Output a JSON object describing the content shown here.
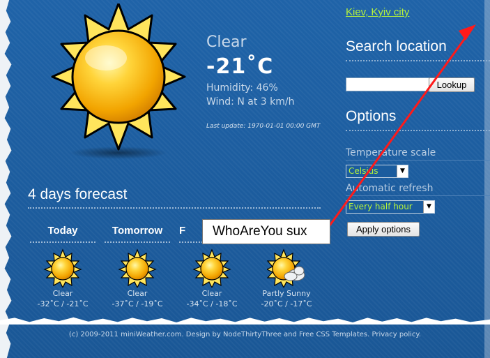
{
  "current": {
    "condition": "Clear",
    "temperature": "-21˚C",
    "humidity": "Humidity: 46%",
    "wind": "Wind: N at 3 km/h",
    "last_update": "Last update: 1970-01-01 00:00 GMT",
    "icon": "sun-icon"
  },
  "forecast": {
    "title": "4 days forecast",
    "days": [
      {
        "day": "Today",
        "condition": "Clear",
        "range": "-32˚C / -21˚C",
        "icon": "sun-icon"
      },
      {
        "day": "Tomorrow",
        "condition": "Clear",
        "range": "-37˚C / -19˚C",
        "icon": "sun-icon"
      },
      {
        "day": "F",
        "condition": "Clear",
        "range": "-34˚C / -18˚C",
        "icon": "sun-icon"
      },
      {
        "day": "",
        "condition": "Partly Sunny",
        "range": "-20˚C / -17˚C",
        "icon": "partly-sunny-icon"
      }
    ]
  },
  "sidebar": {
    "location_link": "Kiev, Kyiv city",
    "search_heading": "Search location",
    "search_value": "",
    "lookup_label": "Lookup",
    "options_heading": "Options",
    "temp_scale_label": "Temperature scale",
    "temp_scale_value": "Celsius",
    "refresh_label": "Automatic refresh",
    "refresh_value": "Every half hour",
    "apply_label": "Apply options"
  },
  "annotation": {
    "text": "WhoAreYou sux",
    "color": "#ff0000"
  },
  "footer": {
    "text": "(c) 2009-2011 miniWeather.com. Design by NodeThirtyThree and Free CSS Templates. Privacy policy."
  },
  "colors": {
    "background": "#1d5ea0",
    "link": "#b5f23c",
    "sun": "#f7c21b"
  }
}
